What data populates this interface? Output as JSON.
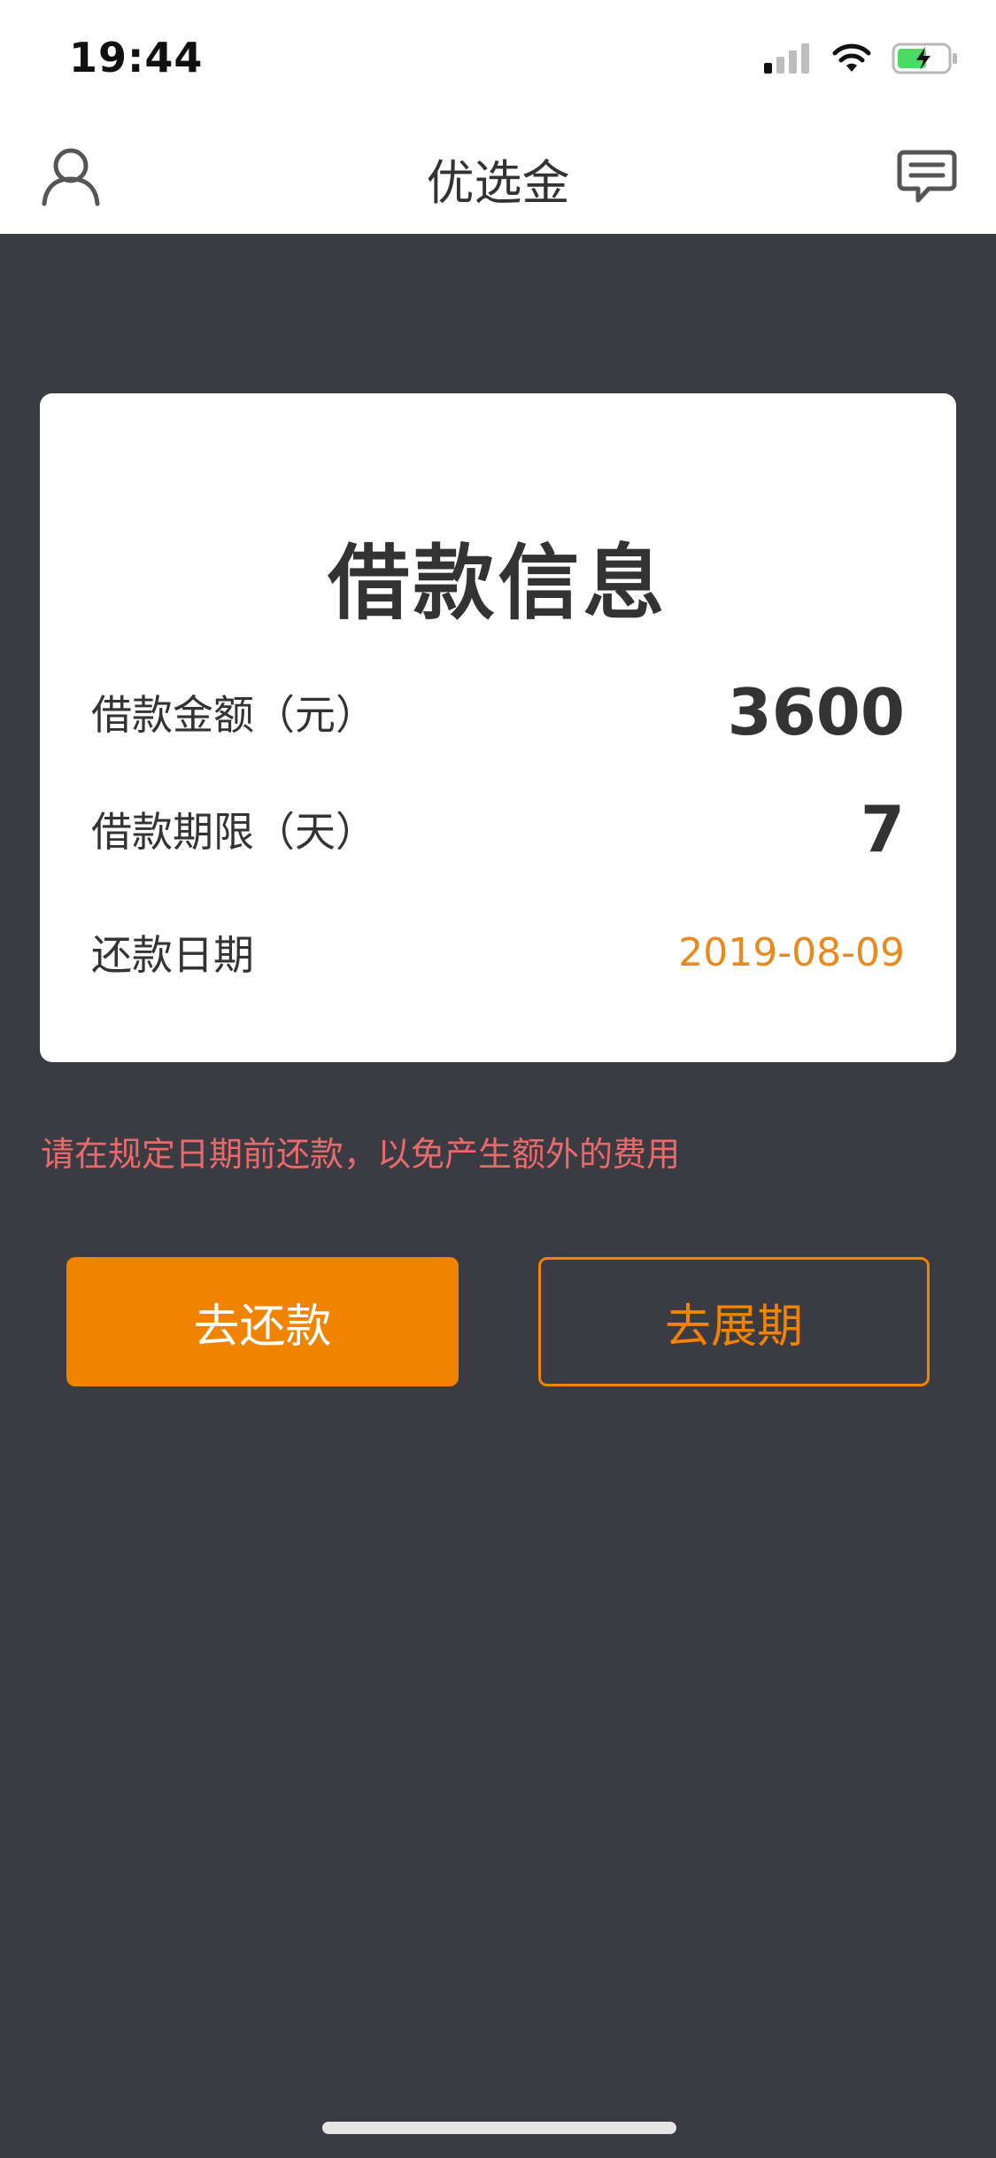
{
  "status_bar": {
    "time": "19:44",
    "signal_icon": "cellular-signal-icon",
    "wifi_icon": "wifi-icon",
    "battery_icon": "battery-charging-icon"
  },
  "nav": {
    "title": "优选金",
    "left_icon": "user-icon",
    "right_icon": "message-icon"
  },
  "loan_card": {
    "title": "借款信息",
    "rows": [
      {
        "label": "借款金额（元）",
        "value": "3600"
      },
      {
        "label": "借款期限（天）",
        "value": "7"
      },
      {
        "label": "还款日期",
        "value": "2019-08-09"
      }
    ]
  },
  "notice": "请在规定日期前还款，以免产生额外的费用",
  "actions": {
    "repay_label": "去还款",
    "extend_label": "去展期"
  },
  "colors": {
    "accent": "#f08300",
    "background": "#3b3b43",
    "notice": "#e96a6a",
    "date": "#ea8a1e"
  }
}
